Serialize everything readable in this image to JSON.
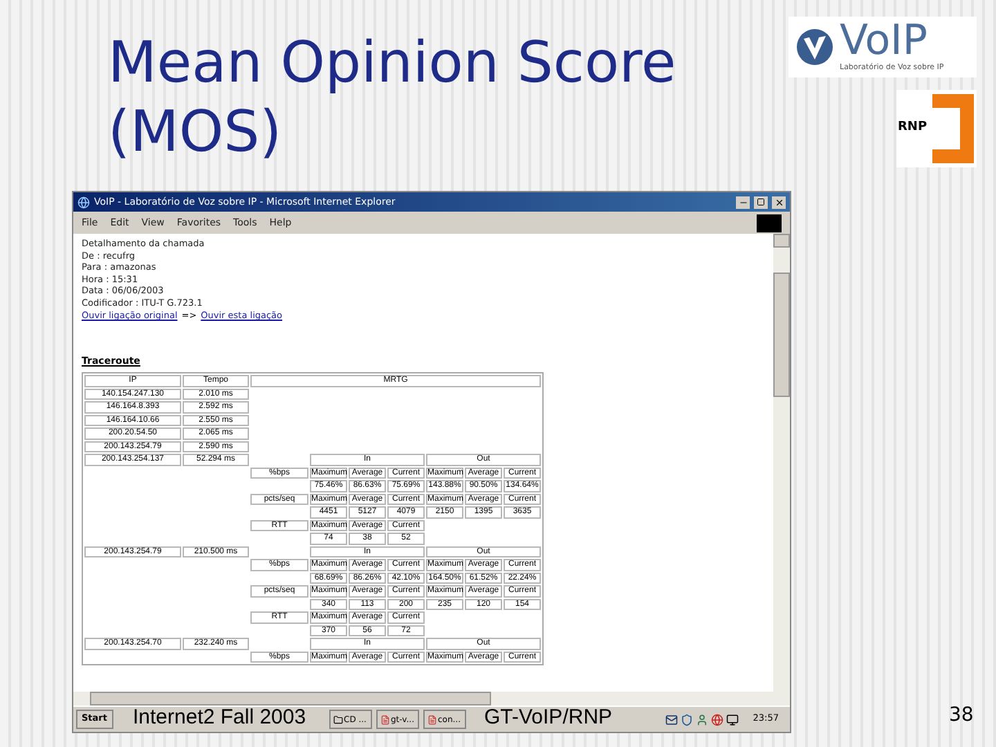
{
  "slide": {
    "title": "Mean Opinion Score (MOS)",
    "logo_text": "VoIP",
    "logo_subtitle": "Laboratório de Voz sobre IP",
    "rnp_logo_text": "RNP",
    "footer_left": "Internet2 Fall 2003",
    "footer_center": "GT-VoIP/RNP",
    "page_number": "38"
  },
  "window": {
    "title": "VoIP - Laboratório de Voz sobre IP - Microsoft Internet Explorer"
  },
  "menu": [
    "File",
    "Edit",
    "View",
    "Favorites",
    "Tools",
    "Help"
  ],
  "details": [
    "Detalhamento da chamada",
    "De : recufrg",
    "Para : amazonas",
    "Hora : 15:31",
    "Data : 06/06/2003",
    "Codificador : ITU-T G.723.1"
  ],
  "links": {
    "original": "Ouvir ligação original",
    "arrow": "=>",
    "current": "Ouvir esta ligação"
  },
  "traceroute": {
    "heading": "Traceroute",
    "columns": [
      "IP",
      "Tempo",
      "MRTG"
    ],
    "hops": [
      {
        "ip": "140.154.247.130",
        "tempo": "2.010 ms"
      },
      {
        "ip": "146.164.8.393",
        "tempo": "2.592 ms"
      },
      {
        "ip": "146.164.10.66",
        "tempo": "2.550 ms"
      },
      {
        "ip": "200.20.54.50",
        "tempo": "2.065 ms"
      },
      {
        "ip": "200.143.254.79",
        "tempo": "2.590 ms"
      },
      {
        "ip": "200.143.254.137",
        "tempo": "52.294 ms",
        "directions": [
          "In",
          "Out"
        ],
        "metrics": [
          {
            "label": "%bps",
            "headers": [
              "Maximum",
              "Average",
              "Current",
              "Maximum",
              "Average",
              "Current"
            ],
            "values": [
              "75.46%",
              "86.63%",
              "75.69%",
              "143.88%",
              "90.50%",
              "134.64%"
            ]
          },
          {
            "label": "pcts/seq",
            "headers": [
              "Maximum",
              "Average",
              "Current",
              "Maximum",
              "Average",
              "Current"
            ],
            "values": [
              "4451",
              "5127",
              "4079",
              "2150",
              "1395",
              "3635"
            ]
          },
          {
            "label": "RTT",
            "headers": [
              "Maximum",
              "Average",
              "Current"
            ],
            "values": [
              "74",
              "38",
              "52"
            ]
          }
        ]
      },
      {
        "ip": "200.143.254.79",
        "tempo": "210.500 ms",
        "directions": [
          "In",
          "Out"
        ],
        "metrics": [
          {
            "label": "%bps",
            "headers": [
              "Maximum",
              "Average",
              "Current",
              "Maximum",
              "Average",
              "Current"
            ],
            "values": [
              "68.69%",
              "86.26%",
              "42.10%",
              "164.50%",
              "61.52%",
              "22.24%"
            ]
          },
          {
            "label": "pcts/seq",
            "headers": [
              "Maximum",
              "Average",
              "Current",
              "Maximum",
              "Average",
              "Current"
            ],
            "values": [
              "340",
              "113",
              "200",
              "235",
              "120",
              "154"
            ]
          },
          {
            "label": "RTT",
            "headers": [
              "Maximum",
              "Average",
              "Current"
            ],
            "values": [
              "370",
              "56",
              "72"
            ]
          }
        ]
      },
      {
        "ip": "200.143.254.70",
        "tempo": "232.240 ms",
        "directions": [
          "In",
          "Out"
        ],
        "metrics": [
          {
            "label": "%bps",
            "headers": [
              "Maximum",
              "Average",
              "Current",
              "Maximum",
              "Average",
              "Current"
            ]
          }
        ]
      }
    ]
  },
  "taskbar": {
    "start": "Start",
    "buttons": [
      "CD ...",
      "gt-v...",
      "con..."
    ],
    "clock": "23:57"
  }
}
